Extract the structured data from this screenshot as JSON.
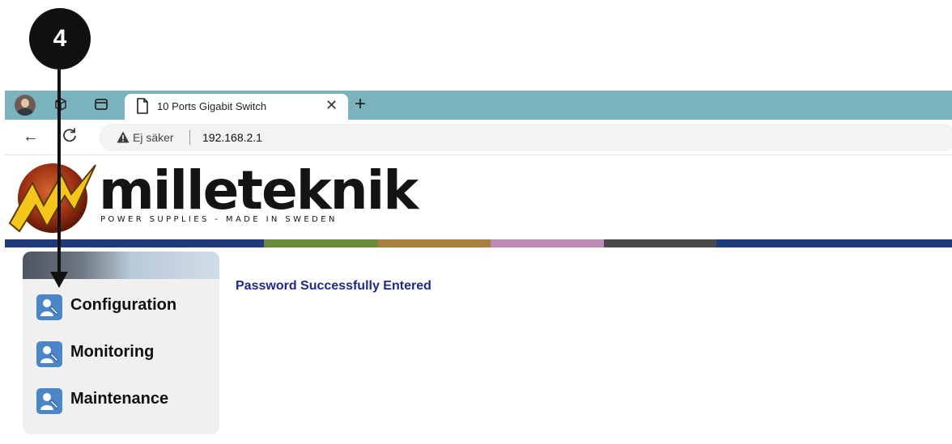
{
  "callout": {
    "step": "4"
  },
  "browser": {
    "tab_title": "10 Ports Gigabit Switch",
    "security_label": "Ej säker",
    "url": "192.168.2.1"
  },
  "brand": {
    "name": "milleteknik",
    "tagline": "POWER SUPPLIES - MADE IN SWEDEN",
    "stripe_colors": [
      "#1e3c78",
      "#6b8a3c",
      "#a87f3e",
      "#bd8ab4",
      "#4a4a4a",
      "#1e3c78"
    ]
  },
  "sidebar": {
    "items": [
      {
        "label": "Configuration",
        "icon": "config-tool-icon"
      },
      {
        "label": "Monitoring",
        "icon": "config-tool-icon"
      },
      {
        "label": "Maintenance",
        "icon": "config-tool-icon"
      }
    ]
  },
  "main": {
    "status_message": "Password Successfully Entered"
  }
}
